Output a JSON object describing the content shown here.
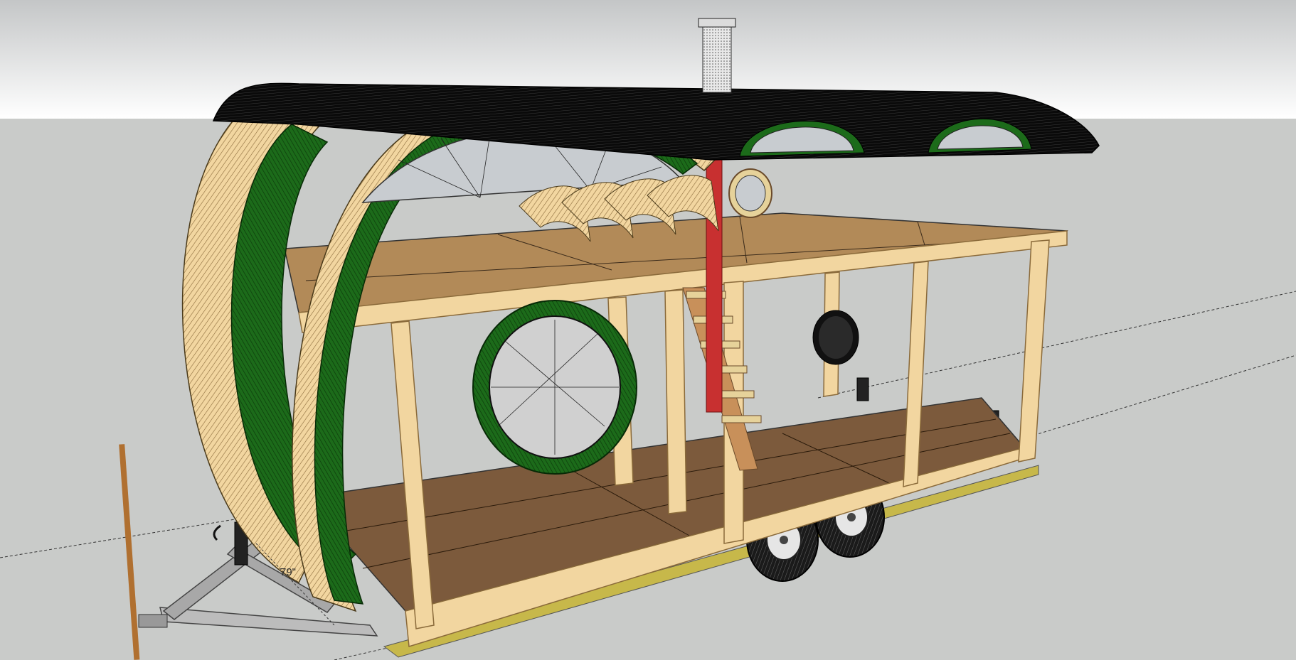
{
  "scene": {
    "dimension_label": "79\"",
    "colors": {
      "sky_top": "#c4c6c7",
      "sky_bottom": "#ffffff",
      "ground": "#c9cbc9",
      "framing_wood": "#f2d6a0",
      "framing_wood_edge": "#c8a66a",
      "floor_plywood": "#7c5a3c",
      "loft_plywood": "#b28a58",
      "green_trim": "#1c6b1a",
      "roof_black": "#0a0a0a",
      "glass": "#c8ccd0",
      "trailer_steel": "#bcbcbc",
      "chimney_red": "#c83030",
      "tongue_pole": "#b07030"
    },
    "components": [
      "barrel-roof",
      "chimney",
      "round-front-frame",
      "fan-window",
      "porthole-window",
      "round-door",
      "loft-floor",
      "floor",
      "wall-studs",
      "staircase",
      "stove-pipe",
      "trailer-frame",
      "trailer-wheels",
      "hitch-tongue",
      "leveling-jacks",
      "dimension-guide"
    ]
  }
}
